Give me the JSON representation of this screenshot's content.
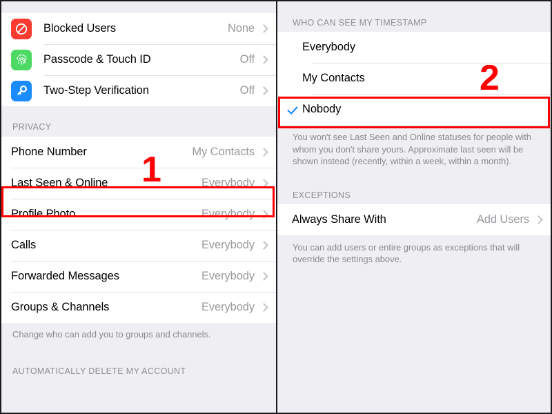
{
  "left_panel": {
    "security_group": {
      "rows": [
        {
          "icon": "block-icon",
          "label": "Blocked Users",
          "value": "None"
        },
        {
          "icon": "fingerprint-icon",
          "label": "Passcode & Touch ID",
          "value": "Off"
        },
        {
          "icon": "key-icon",
          "label": "Two-Step Verification",
          "value": "Off"
        }
      ]
    },
    "privacy_header": "PRIVACY",
    "privacy_group": {
      "rows": [
        {
          "label": "Phone Number",
          "value": "My Contacts"
        },
        {
          "label": "Last Seen & Online",
          "value": "Everybody"
        },
        {
          "label": "Profile Photo",
          "value": "Everybody"
        },
        {
          "label": "Calls",
          "value": "Everybody"
        },
        {
          "label": "Forwarded Messages",
          "value": "Everybody"
        },
        {
          "label": "Groups & Channels",
          "value": "Everybody"
        }
      ]
    },
    "privacy_note": "Change who can add you to groups and channels.",
    "delete_header": "AUTOMATICALLY DELETE MY ACCOUNT"
  },
  "right_panel": {
    "timestamp_header": "WHO CAN SEE MY TIMESTAMP",
    "timestamp_options": [
      {
        "label": "Everybody",
        "checked": false
      },
      {
        "label": "My Contacts",
        "checked": false
      },
      {
        "label": "Nobody",
        "checked": true
      }
    ],
    "timestamp_note": "You won't see Last Seen and Online statuses for people with whom you don't share yours. Approximate last seen will be shown instead (recently, within a week, within a month).",
    "exceptions_header": "EXCEPTIONS",
    "exceptions_group": {
      "rows": [
        {
          "label": "Always Share With",
          "value": "Add Users"
        }
      ]
    },
    "exceptions_note": "You can add users or entire groups as exceptions that will override the settings above."
  },
  "annotations": {
    "step_one": "1",
    "step_two": "2",
    "highlight_color": "#FF0000"
  },
  "theme": {
    "accent_blue": "#0A84FF",
    "group_bg": "#FFFFFF",
    "page_bg": "#EFEEF3",
    "value_gray": "#9A9A9F",
    "header_gray": "#8E8E93",
    "icon_block_red": "#FB3B30",
    "icon_touch_green": "#4CD964",
    "icon_key_blue": "#1A8CFF"
  }
}
